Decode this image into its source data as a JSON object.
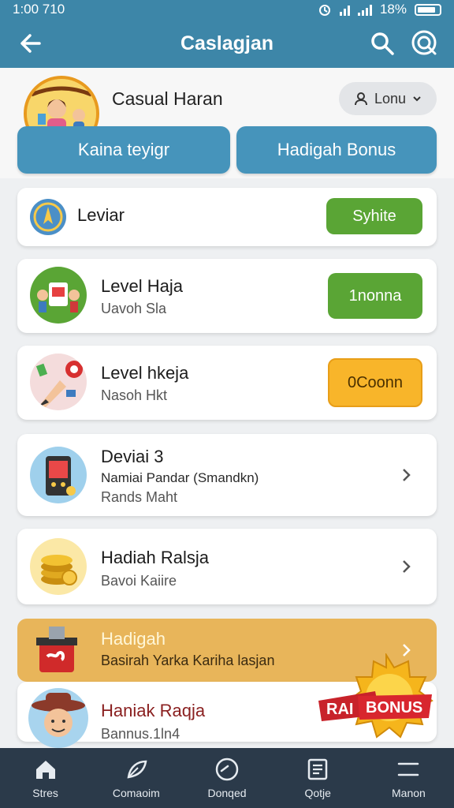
{
  "status_bar": {
    "time": "1:00 710",
    "battery": "18%"
  },
  "app_bar": {
    "title": "Caslagjan"
  },
  "profile": {
    "name": "Casual Haran",
    "login_label": "Lonu",
    "tabs": [
      "Kaina teyigr",
      "Hadigah Bonus"
    ]
  },
  "list": [
    {
      "title": "Leviar",
      "action": "Syhite",
      "action_color": "#5aa535"
    },
    {
      "title": "Level Haja",
      "subtitle": "Uavoh Sla",
      "action": "1nonna",
      "action_color": "#5aa535"
    },
    {
      "title": "Level hkeja",
      "subtitle": "Nasoh Hkt",
      "action": "0Coonn",
      "action_color": "#f8b52a"
    },
    {
      "title": "Deviai 3",
      "subtitle": "Namiai Pandar (Smandkn)",
      "subtitle2": "Rands Maht"
    },
    {
      "title": "Hadiah Ralsja",
      "subtitle": "Bavoi Kaiire"
    }
  ],
  "promo": {
    "title": "Hadigah",
    "subtitle": "Basirah Yarka Kariha lasjan"
  },
  "last_item": {
    "title": "Haniak Raqja",
    "subtitle": "Bannus.1ln4"
  },
  "bonus_badge": {
    "left_text": "RAI",
    "right_text": "BONUS"
  },
  "bottom_nav": [
    "Stres",
    "Comaoim",
    "Donqed",
    "Qotje",
    "Manon"
  ],
  "colors": {
    "primary": "#3d86a8",
    "green": "#5aa535",
    "yellow": "#f8b52a",
    "promo": "#e8b55a",
    "nav": "#2b3a4a"
  }
}
